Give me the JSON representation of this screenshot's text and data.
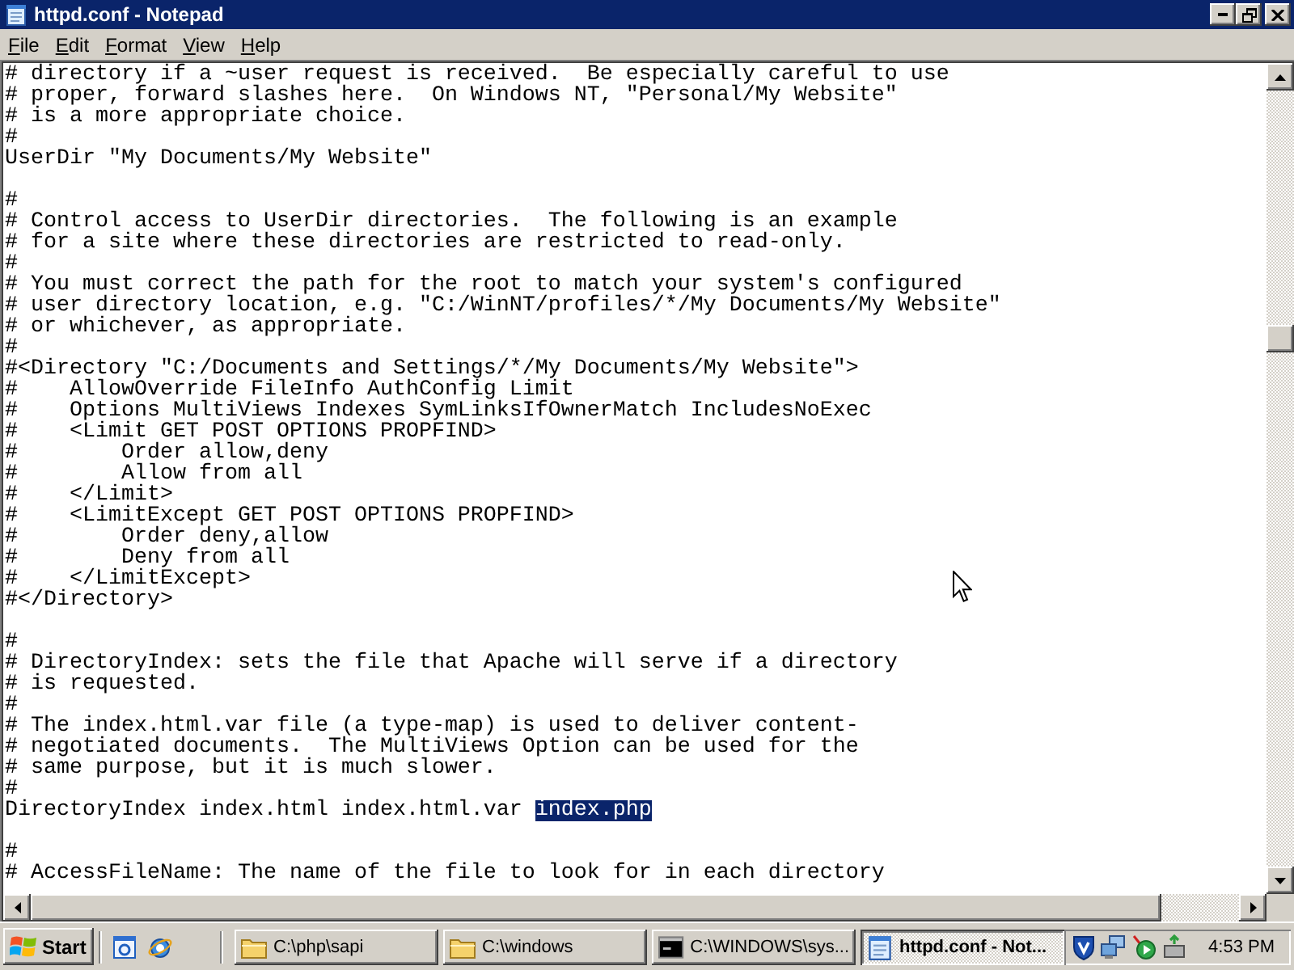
{
  "window": {
    "title": "httpd.conf - Notepad"
  },
  "menu": [
    "File",
    "Edit",
    "Format",
    "View",
    "Help"
  ],
  "editor": {
    "blocks": [
      [
        "# directory if a ~user request is received.  Be especially careful to use",
        "# proper, forward slashes here.  On Windows NT, \"Personal/My Website\"",
        "# is a more appropriate choice.",
        "#",
        "UserDir \"My Documents/My Website\""
      ],
      [
        "#",
        "# Control access to UserDir directories.  The following is an example",
        "# for a site where these directories are restricted to read-only.",
        "#",
        "# You must correct the path for the root to match your system's configured",
        "# user directory location, e.g. \"C:/WinNT/profiles/*/My Documents/My Website\"",
        "# or whichever, as appropriate.",
        "#",
        "#<Directory \"C:/Documents and Settings/*/My Documents/My Website\">",
        "#    AllowOverride FileInfo AuthConfig Limit",
        "#    Options MultiViews Indexes SymLinksIfOwnerMatch IncludesNoExec",
        "#    <Limit GET POST OPTIONS PROPFIND>",
        "#        Order allow,deny",
        "#        Allow from all",
        "#    </Limit>",
        "#    <LimitExcept GET POST OPTIONS PROPFIND>",
        "#        Order deny,allow",
        "#        Deny from all",
        "#    </LimitExcept>",
        "#</Directory>"
      ],
      [
        "#",
        "# DirectoryIndex: sets the file that Apache will serve if a directory",
        "# is requested.",
        "#",
        "# The index.html.var file (a type-map) is used to deliver content-",
        "# negotiated documents.  The MultiViews Option can be used for the",
        "# same purpose, but it is much slower.",
        "#",
        {
          "segments": [
            {
              "text": "DirectoryIndex index.html index.html.var ",
              "selected": false
            },
            {
              "text": "index.php",
              "selected": true
            }
          ]
        }
      ],
      [
        "#",
        "# AccessFileName: The name of the file to look for in each directory"
      ]
    ]
  },
  "taskbar": {
    "start": "Start",
    "tasks": [
      {
        "kind": "folder",
        "label": "C:\\php\\sapi",
        "selected": false
      },
      {
        "kind": "folder",
        "label": "C:\\windows",
        "selected": false
      },
      {
        "kind": "console",
        "label": "C:\\WINDOWS\\sys...",
        "selected": false
      },
      {
        "kind": "notepad",
        "label": "httpd.conf - Not...",
        "selected": true
      }
    ],
    "clock": "4:53 PM"
  }
}
